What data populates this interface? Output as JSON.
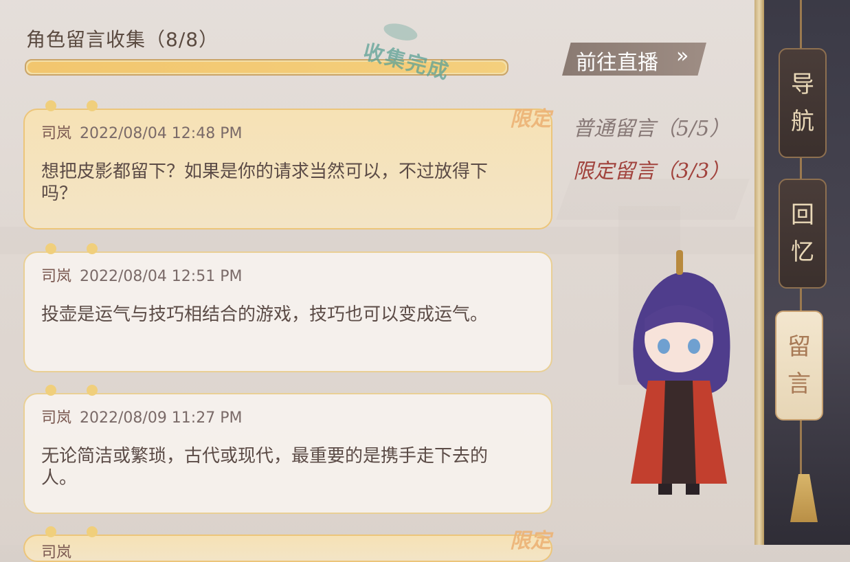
{
  "header": {
    "title": "角色留言收集（8/8）",
    "progress": 1.0,
    "stamp_text": "收集完成"
  },
  "goto_button": {
    "label": "前往直播",
    "arrow": "»"
  },
  "stats": {
    "normal": "普通留言（5/5）",
    "limited": "限定留言（3/3）"
  },
  "messages": [
    {
      "author": "司岚",
      "datetime": "2022/08/04  12:48  PM",
      "text": "想把皮影都留下？如果是你的请求当然可以，不过放得下吗？",
      "limited": true,
      "badge": "限定"
    },
    {
      "author": "司岚",
      "datetime": "2022/08/04  12:51  PM",
      "text": "投壶是运气与技巧相结合的游戏，技巧也可以变成运气。",
      "limited": false
    },
    {
      "author": "司岚",
      "datetime": "2022/08/09  11:27  PM",
      "text": "无论简洁或繁琐，古代或现代，最重要的是携手走下去的人。",
      "limited": false
    },
    {
      "author": "司岚",
      "datetime": "",
      "text": "",
      "limited": true,
      "badge": "限定"
    }
  ],
  "nav": [
    {
      "label_1": "导",
      "label_2": "航",
      "active": false
    },
    {
      "label_1": "回",
      "label_2": "忆",
      "active": false
    },
    {
      "label_1": "留",
      "label_2": "言",
      "active": true
    }
  ],
  "colors": {
    "accent_gold": "#e9cf94",
    "limited_red": "#a1433d",
    "progress_fill": "#f2c66e",
    "stamp_green": "#5ca096"
  },
  "icons": {
    "goto_arrow": "double-chevron-right-icon",
    "character": "chibi-character-icon"
  }
}
